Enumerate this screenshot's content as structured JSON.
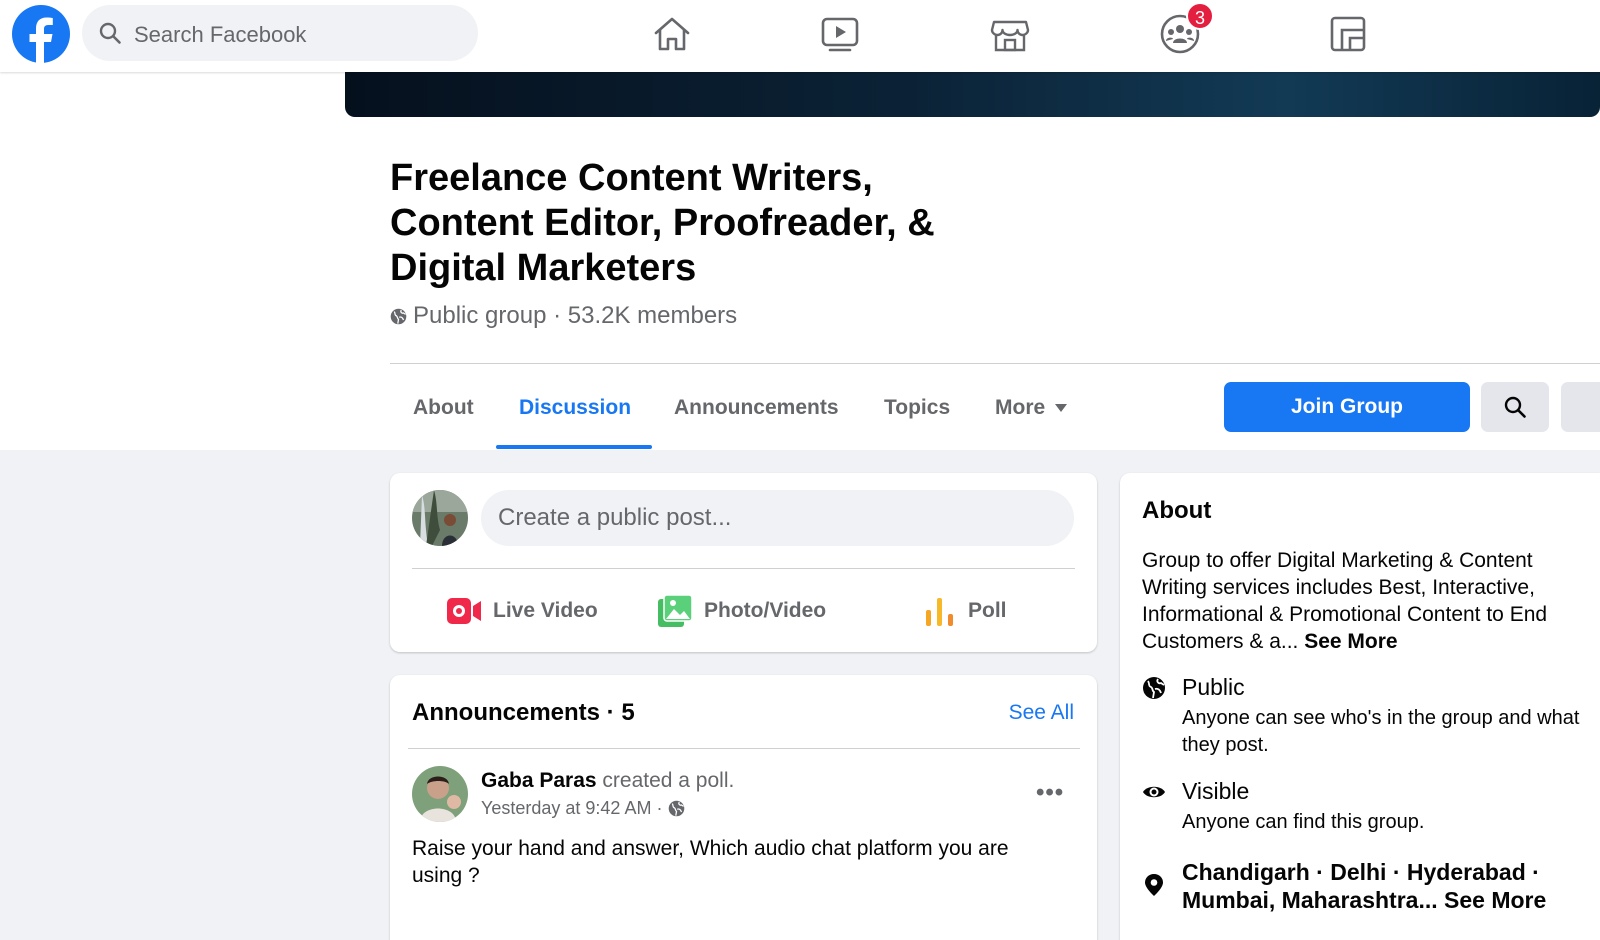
{
  "topbar": {
    "logo_icon": "facebook-logo-icon",
    "search_placeholder": "Search Facebook",
    "nav": [
      {
        "icon": "home-icon"
      },
      {
        "icon": "watch-icon"
      },
      {
        "icon": "marketplace-icon"
      },
      {
        "icon": "groups-icon",
        "badge": "3"
      },
      {
        "icon": "gaming-icon"
      }
    ]
  },
  "group": {
    "title": "Freelance Content Writers, Content Editor, Proofreader, & Digital Marketers",
    "meta": "Public group · 53.2K members",
    "privacy_icon": "globe-icon"
  },
  "tabs": [
    {
      "label": "About",
      "active": false
    },
    {
      "label": "Discussion",
      "active": true
    },
    {
      "label": "Announcements",
      "active": false
    },
    {
      "label": "Topics",
      "active": false
    },
    {
      "label": "More",
      "active": false
    }
  ],
  "actions": {
    "join_label": "Join Group",
    "search_icon": "search-icon"
  },
  "composer": {
    "placeholder": "Create a public post...",
    "buttons": [
      {
        "label": "Live Video",
        "icon": "live-video-icon",
        "color": "#f02849"
      },
      {
        "label": "Photo/Video",
        "icon": "photo-video-icon",
        "color": "#45bd62"
      },
      {
        "label": "Poll",
        "icon": "poll-icon",
        "color": "#f7b928"
      }
    ]
  },
  "announcements": {
    "title": "Announcements · 5",
    "see_all": "See All",
    "post": {
      "author": "Gaba Paras",
      "action": " created a poll.",
      "time": "Yesterday at 9:42 AM ·",
      "text": "Raise your hand and answer, Which audio chat platform you are using ?"
    }
  },
  "about": {
    "title": "About",
    "description": "Group to offer Digital Marketing & Content Writing services includes Best, Interactive, Informational & Promotional Content to End Customers & a...",
    "see_more": "See More",
    "rows": [
      {
        "icon": "globe-icon",
        "title": "Public",
        "sub": "Anyone can see who's in the group and what they post."
      },
      {
        "icon": "eye-icon",
        "title": "Visible",
        "sub": "Anyone can find this group."
      }
    ],
    "location_line1": "Chandigarh · Delhi · Hyderabad ·",
    "location_line2": "Mumbai, Maharashtra...",
    "location_see_more": "See More",
    "location_icon": "location-pin-icon"
  },
  "colors": {
    "brand": "#1877f2",
    "badge": "#e41e3f"
  }
}
